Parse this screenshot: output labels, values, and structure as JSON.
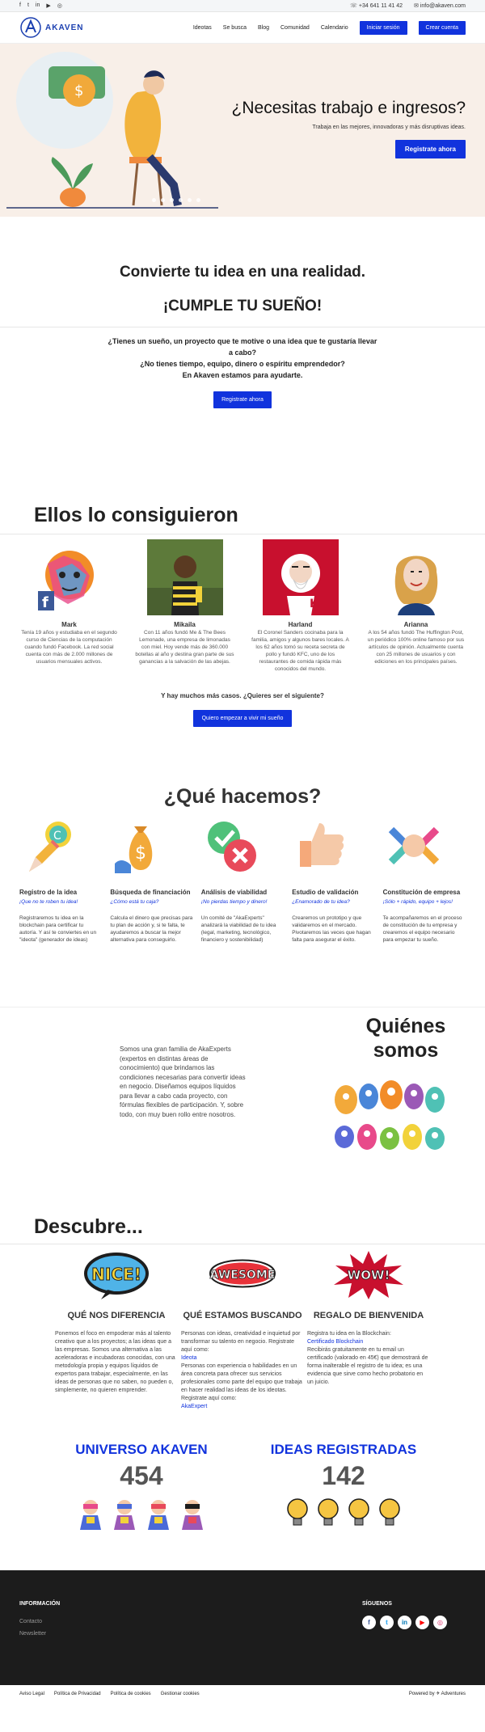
{
  "topbar": {
    "social": [
      "f",
      "t",
      "in",
      "▶",
      "◎"
    ],
    "phone": "+34 641 11 41 42",
    "email": "info@akaven.com"
  },
  "header": {
    "logo_text": "AKAVEN",
    "nav": [
      "Ideotas",
      "Se busca",
      "Blog",
      "Comunidad",
      "Calendario"
    ],
    "login": "Iniciar sesión",
    "signup": "Crear cuenta"
  },
  "hero": {
    "title": "¿Necesitas trabajo e ingresos?",
    "subtitle": "Trabaja en las mejores, innovadoras y más disruptivas ideas.",
    "cta": "Registrate ahora"
  },
  "intro": {
    "title": "Convierte tu idea en una realidad.",
    "title2": "¡CUMPLE TU SUEÑO!",
    "q1": "¿Tienes un sueño, un proyecto que te motive o una idea que te gustaría llevar a cabo?",
    "q2": "¿No tienes tiempo, equipo, dinero o espíritu emprendedor?",
    "q3": "En Akaven estamos para ayudarte.",
    "cta": "Registrate ahora"
  },
  "success": {
    "title": "Ellos lo consiguieron",
    "people": [
      {
        "name": "Mark",
        "desc": "Tenía 19 años y estudiaba en el segundo curso de Ciencias de la computación cuando fundó Facebook. La red social cuenta con más de 2.000 millones de usuarios mensuales activos."
      },
      {
        "name": "Mikaila",
        "desc": "Con 11 años fundó Me & The Bees Lemonade, una empresa de limonadas con miel. Hoy vende más de 360.000 botellas al año y destina gran parte de sus ganancias a la salvación de las abejas."
      },
      {
        "name": "Harland",
        "desc": "El Coronel Sanders cocinaba para la familia, amigos y algunos bares locales. A los 62 años tomó su receta secreta de pollo y fundó KFC, uno de los restaurantes de comida rápida más conocidos del mundo."
      },
      {
        "name": "Arianna",
        "desc": "A los 54 años fundó The Huffington Post, un periódico 100% online famoso por sus artículos de opinión. Actualmente cuenta con 25 millones de usuarios y con ediciones en los principales países."
      }
    ],
    "more": "Y hay muchos más casos. ¿Quieres ser el siguiente?",
    "cta": "Quiero empezar a vivir mi sueño"
  },
  "what": {
    "title": "¿Qué hacemos?",
    "services": [
      {
        "title": "Registro de la idea",
        "tag": "¡Que no te roben tu idea!",
        "text": "Registraremos tu idea en la blockchain para certificar tu autoría. Y así te conviertes en un \"ideota\" (generador de ideas)"
      },
      {
        "title": "Búsqueda de financiación",
        "tag": "¿Cómo está tu caja?",
        "text": "Calcula el dinero que precisas para tu plan de acción y, si te falta, te ayudaremos a buscar la mejor alternativa para conseguirlo."
      },
      {
        "title": "Análisis de viabilidad",
        "tag": "¡No pierdas tiempo y dinero!",
        "text": "Un comité de \"AkaExperts\" analizará la viabilidad de tu idea (legal, marketing, tecnológico, financiero y sostenibilidad)"
      },
      {
        "title": "Estudio de validación",
        "tag": "¿Enamorado de tu idea?",
        "text": "Crearemos un prototipo y que validaremos en el mercado. Pivotaremos las veces que hagan falta para asegurar el éxito."
      },
      {
        "title": "Constitución de empresa",
        "tag": "¡Sólo + rápido, equipo + lejos!",
        "text": "Te acompañaremos en el proceso de constitución de tu empresa y crearemos el equipo necesario para empezar tu sueño."
      }
    ]
  },
  "who": {
    "title": "Quiénes somos",
    "blurb": "Somos una gran familia de AkaExperts (expertos en distintas áreas de conocimiento) que brindamos las condiciones necesarias para convertir ideas en negocio. Diseñamos equipos líquidos para llevar a cabo cada proyecto, con fórmulas flexibles de participación. Y, sobre todo, con muy buen rollo entre nosotros."
  },
  "discover": {
    "title": "Descubre...",
    "badges": [
      "NICE!",
      "AWESOME",
      "WOW!"
    ],
    "col1": {
      "title": "QUÉ NOS DIFERENCIA",
      "body": "Ponemos el foco en empoderar más al talento creativo que a los proyectos; a las ideas que a las empresas. Somos una alternativa a las aceleradoras e incubadoras conocidas, con una metodología propia y equipos líquidos de expertos para trabajar, especialmente, en las ideas de personas que no saben, no pueden o, simplemente, no quieren emprender."
    },
    "col2": {
      "title": "QUÉ ESTAMOS BUSCANDO",
      "body1": "Personas con ideas, creatividad e inquietud por transformar su talento en negocio. Registrate aquí como:",
      "link1": "Ideota",
      "body2": "Personas con experiencia o habilidades en un área concreta para ofrecer sus servicios profesionales como parte del equipo que trabaja en hacer realidad las ideas de los ideotas. Registrate aquí como:",
      "link2": "AkaExpert"
    },
    "col3": {
      "title": "REGALO DE BIENVENIDA",
      "body1": "Registra tu idea en la Blockchain:",
      "link": "Certificado Blockchain",
      "body2": "Recibirás gratuitamente en tu email un certificado (valorado en 45€) que demostrará de forma inalterable el registro de tu idea; es una evidencia que sirve como hecho probatorio en un juicio."
    }
  },
  "stats": {
    "universe_label": "UNIVERSO AKAVEN",
    "universe_value": "454",
    "ideas_label": "IDEAS REGISTRADAS",
    "ideas_value": "142"
  },
  "footer": {
    "info_title": "INFORMACIÓN",
    "links": [
      "Contacto",
      "Newsletter"
    ],
    "follow_title": "SÍGUENOS",
    "social": [
      "f",
      "t",
      "in",
      "▶",
      "◎"
    ],
    "legal": [
      "Aviso Legal",
      "Política de Privacidad",
      "Política de cookies",
      "Gestionar cookies"
    ],
    "powered": "Powered by",
    "powered_brand": "Adventures"
  },
  "colors": {
    "accent": "#1133dd",
    "hero_bg": "#f8efe8",
    "footer_bg": "#1c1c1c"
  }
}
